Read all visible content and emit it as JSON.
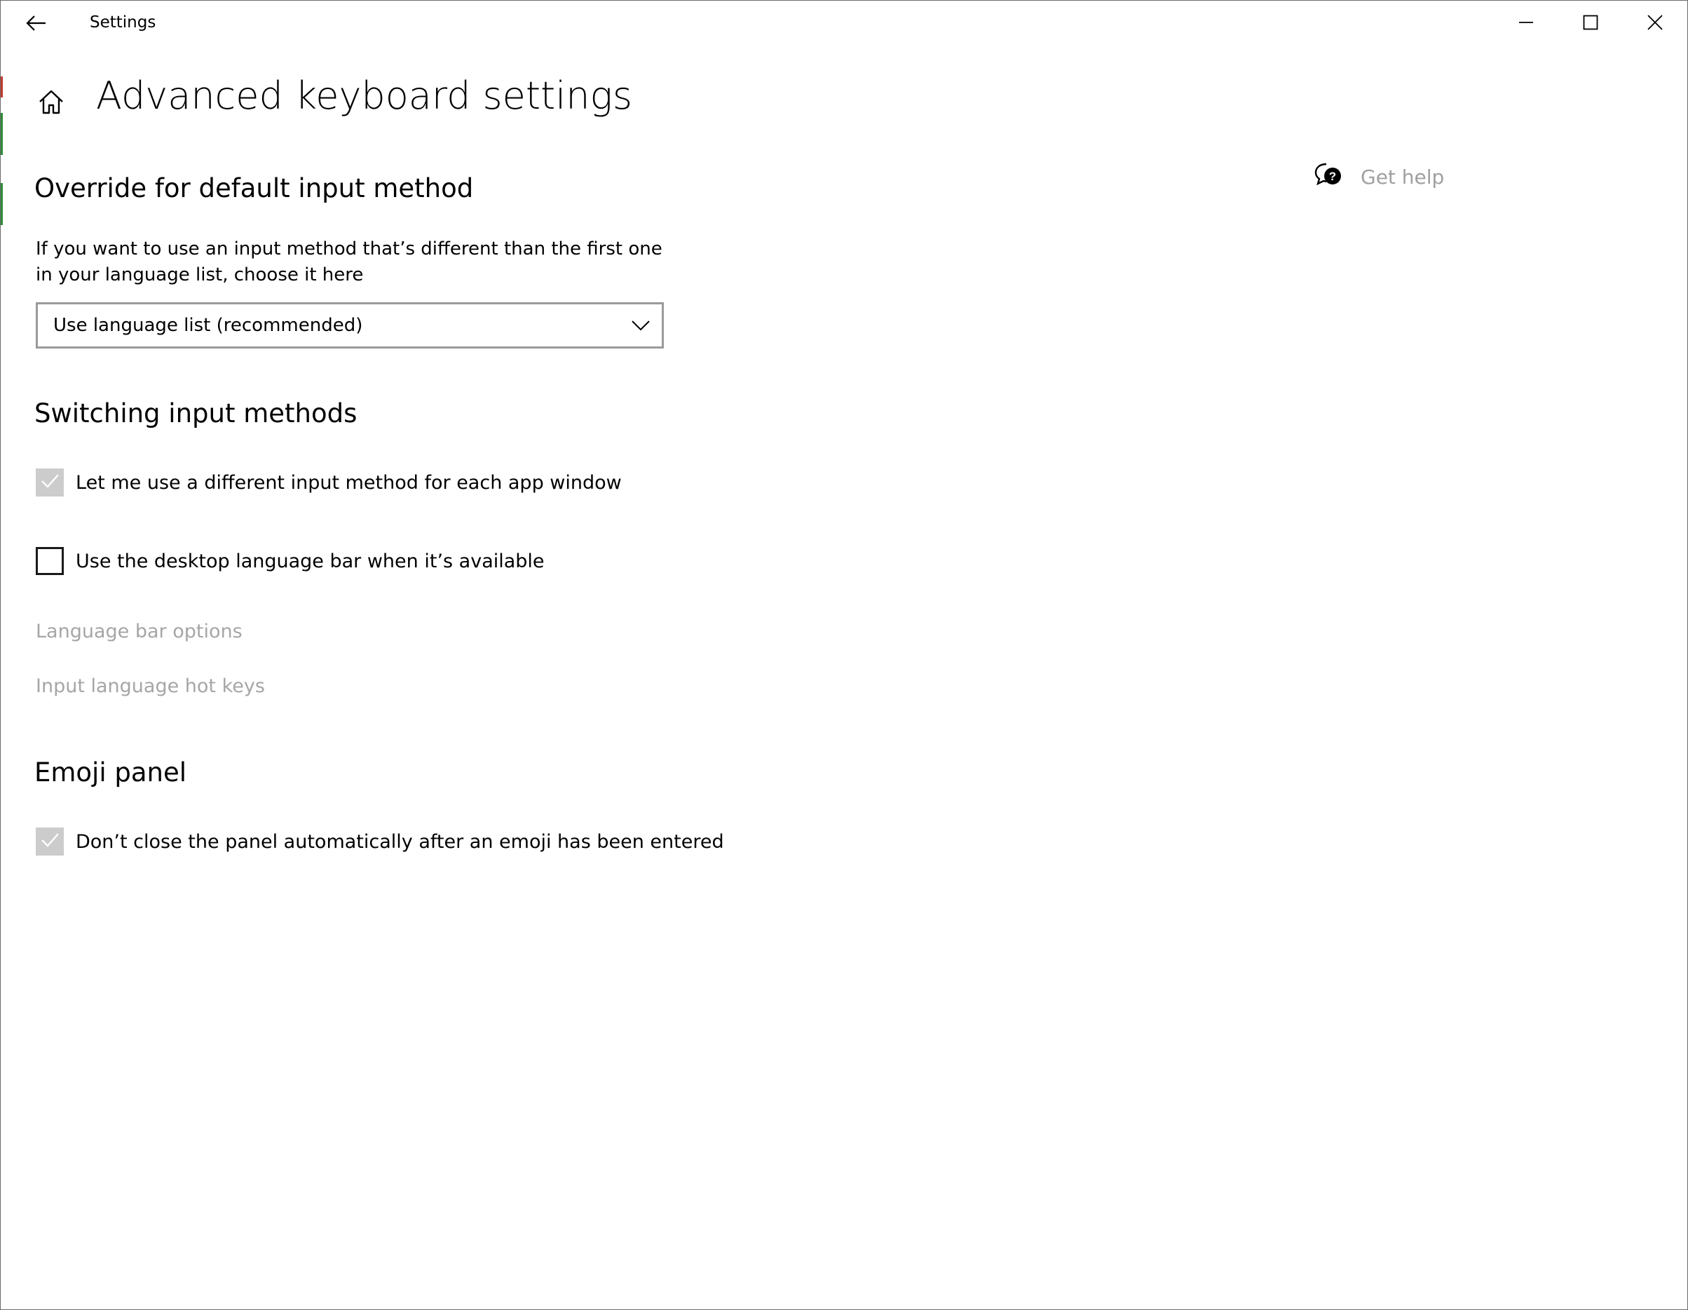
{
  "window": {
    "app_title": "Settings",
    "controls": {
      "back": "back-arrow-icon",
      "minimize": "minimize-icon",
      "maximize": "maximize-icon",
      "close": "close-icon"
    }
  },
  "header": {
    "home_icon": "home-icon",
    "page_title": "Advanced keyboard settings"
  },
  "help": {
    "icon": "chat-help-icon",
    "label": "Get help"
  },
  "override_section": {
    "title": "Override for default input method",
    "description": "If you want to use an input method that’s different than the first one in your language list, choose it here",
    "dropdown": {
      "selected": "Use language list (recommended)"
    }
  },
  "switching_section": {
    "title": "Switching input methods",
    "options": [
      {
        "label": "Let me use a different input method for each app window",
        "checked": true,
        "disabled": true
      },
      {
        "label": "Use the desktop language bar when it’s available",
        "checked": false,
        "disabled": false
      }
    ],
    "links": [
      {
        "label": "Language bar options",
        "disabled": true
      },
      {
        "label": "Input language hot keys",
        "disabled": true
      }
    ]
  },
  "emoji_section": {
    "title": "Emoji panel",
    "options": [
      {
        "label": "Don’t close the panel automatically after an emoji has been entered",
        "checked": true,
        "disabled": true
      }
    ]
  },
  "colors": {
    "disabled_text": "#a6a6a6",
    "disabled_check_fill": "#cccccc",
    "border": "#9a9a9a"
  }
}
